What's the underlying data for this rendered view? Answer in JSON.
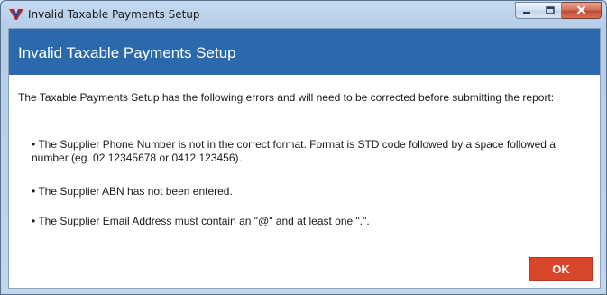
{
  "window": {
    "title": "Invalid Taxable Payments Setup",
    "controls": {
      "minimize_icon": "minimize-icon",
      "maximize_icon": "maximize-icon",
      "close_icon": "close-icon"
    }
  },
  "dialog": {
    "header_title": "Invalid Taxable Payments Setup",
    "intro": "The Taxable Payments Setup has the following errors and will need to be corrected before submitting the report:",
    "errors": [
      "• The Supplier Phone Number is not in the correct format. Format is STD code followed by a space followed a number (eg. 02 12345678 or 0412 123456).",
      "• The Supplier ABN has not been entered.",
      "• The Supplier Email Address must contain an \"@\" and at least one \".\"."
    ],
    "ok_label": "OK"
  },
  "colors": {
    "header_bg": "#2a6aac",
    "ok_button_bg": "#d9472b",
    "close_button_bg": "#c24a32"
  }
}
